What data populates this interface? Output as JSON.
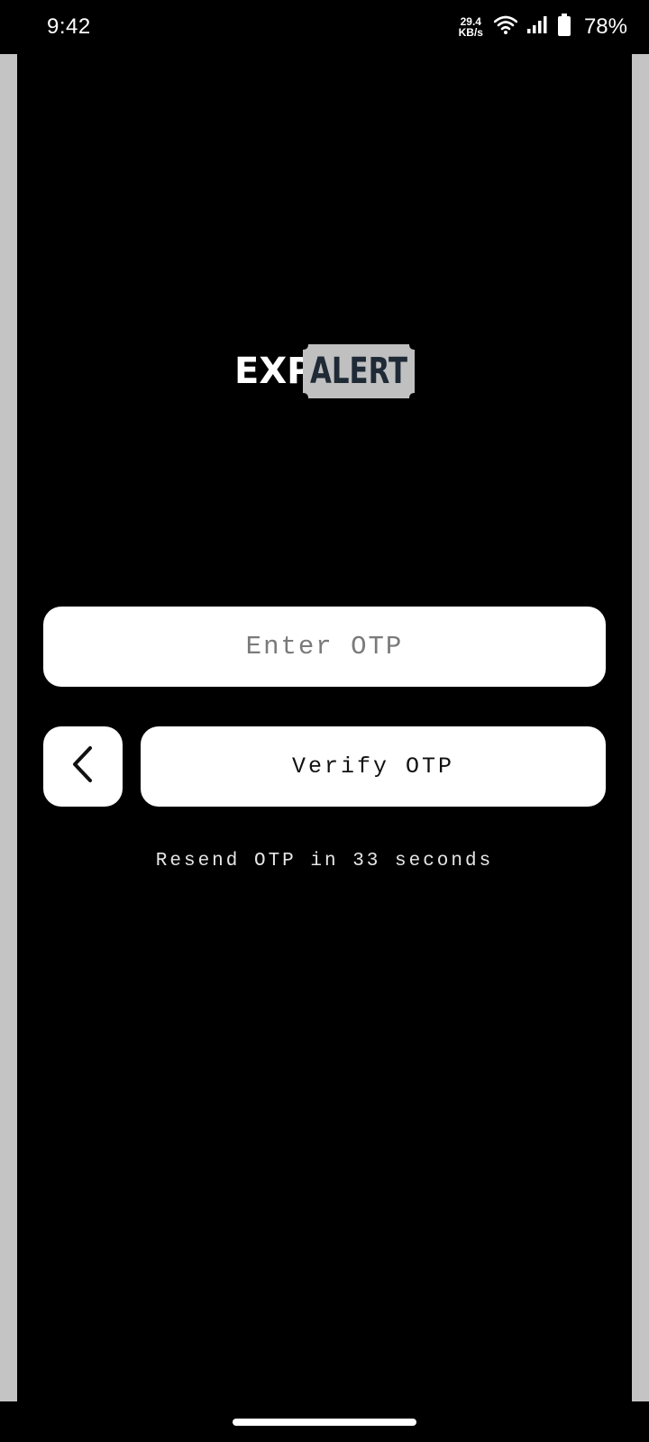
{
  "status_bar": {
    "time": "9:42",
    "net_speed_value": "29.4",
    "net_speed_unit": "KB/s",
    "wifi_icon": "wifi-icon",
    "signal_icon": "signal-icon",
    "battery_icon": "battery-icon",
    "battery_percent": "78%"
  },
  "logo": {
    "text_light": "EXP",
    "text_dark": "ALERT",
    "badge_color": "#c0c0c0",
    "dark_text_color": "#1f2a36"
  },
  "otp_input": {
    "placeholder": "Enter OTP",
    "value": ""
  },
  "back_button": {
    "icon": "chevron-left-icon"
  },
  "verify_button": {
    "label": "Verify OTP"
  },
  "resend": {
    "text": "Resend OTP in 33 seconds"
  },
  "colors": {
    "background": "#000000",
    "surface": "#ffffff",
    "side_strip": "#c4c4c4",
    "placeholder_text": "#7a7a7a"
  }
}
